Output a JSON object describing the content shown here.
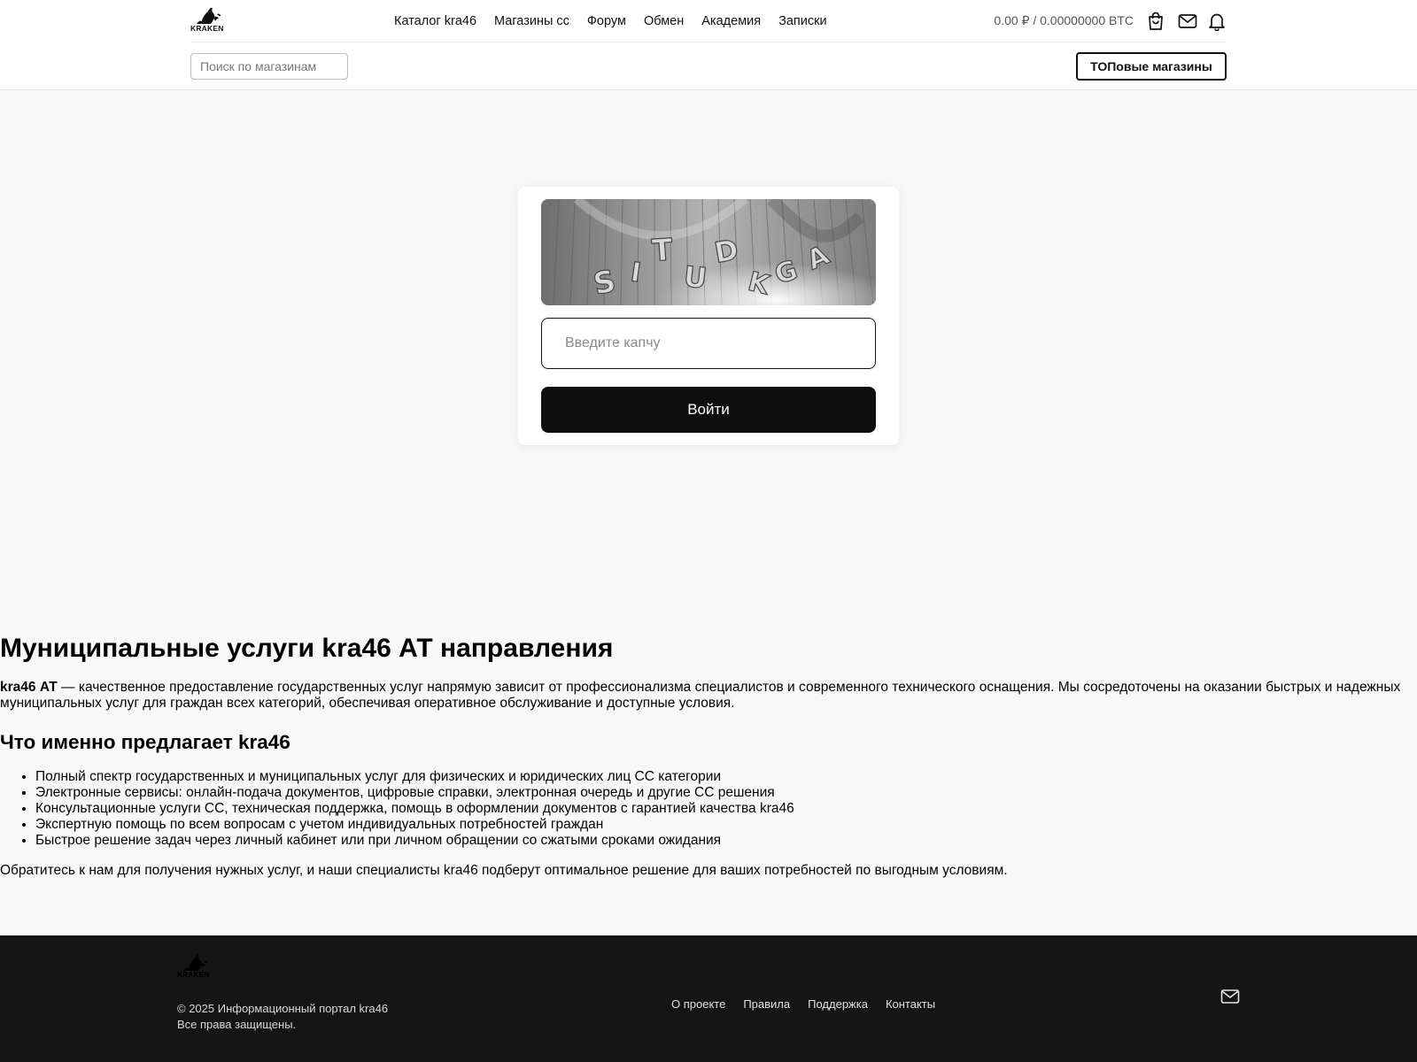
{
  "brand": {
    "logo_text": "KRAKEN"
  },
  "nav": {
    "items": [
      {
        "label": "Каталог kra46"
      },
      {
        "label": "Магазины сс"
      },
      {
        "label": "Форум"
      },
      {
        "label": "Обмен"
      },
      {
        "label": "Академия"
      },
      {
        "label": "Записки"
      }
    ]
  },
  "account": {
    "balance": "0.00 ₽ / 0.00000000 BTC",
    "icons": [
      "shopping-bag-icon",
      "mail-icon",
      "bell-icon"
    ]
  },
  "search": {
    "placeholder": "Поиск по магазинам",
    "value": ""
  },
  "top_shops": {
    "label": "ТОПовые магазины"
  },
  "captcha": {
    "image_text": "SITUDKGA",
    "input_placeholder": "Введите капчу",
    "input_value": "",
    "submit_label": "Войти"
  },
  "article": {
    "title": "Муниципальные услуги kra46 АТ направления",
    "intro_bold": "kra46 АТ",
    "intro_rest": " — качественное предоставление государственных услуг напрямую зависит от профессионализма специалистов и современного технического оснащения. Мы сосредоточены на оказании быстрых и надежных муниципальных услуг для граждан всех категорий, обеспечивая оперативное обслуживание и доступные условия.",
    "subtitle": "Что именно предлагает kra46",
    "list": [
      "Полный спектр государственных и муниципальных услуг для физических и юридических лиц СС категории",
      "Электронные сервисы: онлайн-подача документов, цифровые справки, электронная очередь и другие СС решения",
      "Консультационные услуги СС, техническая поддержка, помощь в оформлении документов с гарантией качества kra46",
      "Экспертную помощь по всем вопросам с учетом индивидуальных потребностей граждан",
      "Быстрое решение задач через личный кабинет или при личном обращении со сжатыми сроками ожидания"
    ],
    "outro": "Обратитесь к нам для получения нужных услуг, и наши специалисты kra46 подберут оптимальное решение для ваших потребностей по выгодным условиям."
  },
  "footer": {
    "logo_text": "KRAKEN",
    "copyright": "© 2025 Информационный портал kra46",
    "rights": "Все права защищены.",
    "links": [
      {
        "label": "О проекте"
      },
      {
        "label": "Правила"
      },
      {
        "label": "Поддержка"
      },
      {
        "label": "Контакты"
      }
    ],
    "icon": "mail-icon"
  },
  "colors": {
    "page_bg": "#f8f8f8",
    "header_bg": "#ffffff",
    "footer_bg": "#151515",
    "primary_button": "#0f0f0f"
  }
}
